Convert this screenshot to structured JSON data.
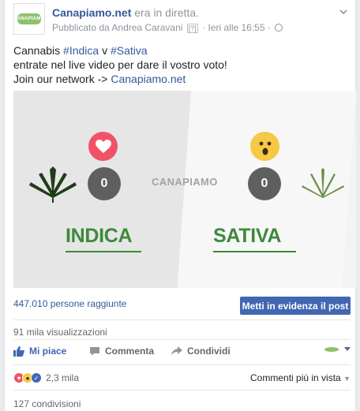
{
  "post": {
    "page_name": "Canapiamo.net",
    "live_suffix": "era in diretta.",
    "published_by": "Pubblicato da Andrea Caravani",
    "question_mark": "[?]",
    "timestamp": "· Ieri alle 16:55 ·",
    "avatar_text": "CANAPIAMO",
    "text_line1_prefix": "Cannabis ",
    "hashtag_indica": "#Indica",
    "text_line1_mid": " v ",
    "hashtag_sativa": "#Sativa",
    "text_line2": "entrate nel live video per dare il vostro voto!",
    "text_line3_prefix": "Join our network -> ",
    "network_link": "Canapiamo.net"
  },
  "video": {
    "brand": "CANAPIAMO",
    "indica_label": "INDICA",
    "sativa_label": "SATIVA",
    "indica_count": "0",
    "sativa_count": "0",
    "colors": {
      "green": "#3d8a3a",
      "love": "#f25268",
      "wow": "#f7c843"
    }
  },
  "stats": {
    "reach": "447.010 persone raggiunte",
    "boost_label": "Metti in evidenza il post",
    "views": "91 mila visualizzazioni"
  },
  "actions": {
    "like": "Mi piace",
    "comment": "Commenta",
    "share": "Condividi"
  },
  "footer": {
    "reaction_count": "2,3 mila",
    "sort_label": "Commenti più in vista",
    "shares": "127 condivisioni"
  }
}
